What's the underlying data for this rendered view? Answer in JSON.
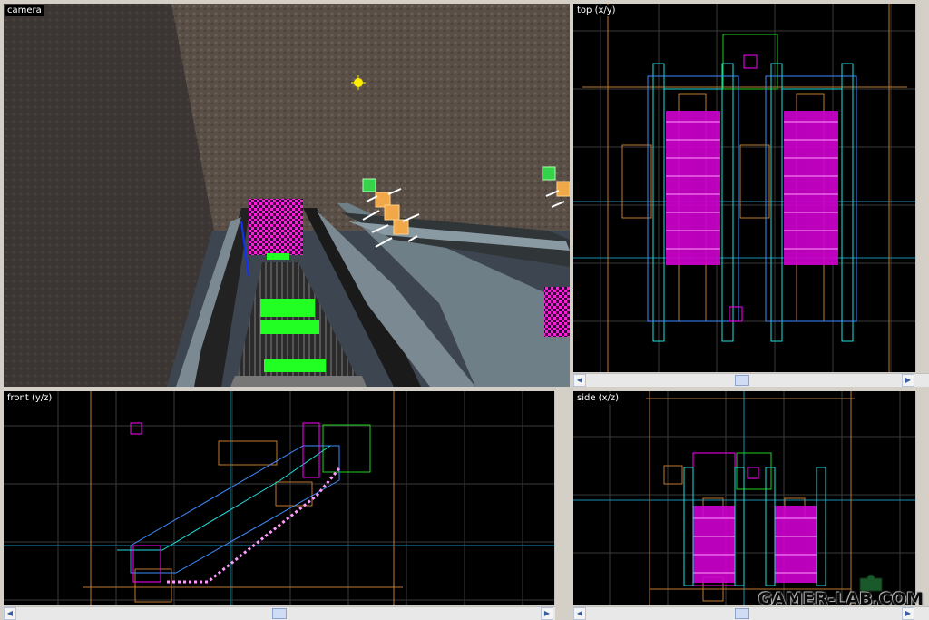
{
  "viewports": {
    "camera": {
      "label": "camera"
    },
    "top": {
      "label": "top (x/y)"
    },
    "front": {
      "label": "front (y/z)"
    },
    "side": {
      "label": "side (x/z)"
    }
  },
  "watermark": {
    "text": "GAMER-LAB.COM"
  },
  "icons": {
    "light": "light-bulb-icon",
    "entity": "entity-cube-icon",
    "scroll_left": "arrow-left-icon",
    "scroll_right": "arrow-right-icon",
    "scroll_up": "arrow-up-icon",
    "scroll_down": "arrow-down-icon"
  },
  "colors": {
    "viewport_bg": "#000000",
    "grid": "#3a3a3a",
    "brush_blue": "#3f8cff",
    "brush_magenta": "#ff00ff",
    "brush_orange": "#e08a2a",
    "brush_green": "#20d020",
    "brush_cyan": "#20e0e0",
    "texture_magenta": "#ff1fd8"
  }
}
